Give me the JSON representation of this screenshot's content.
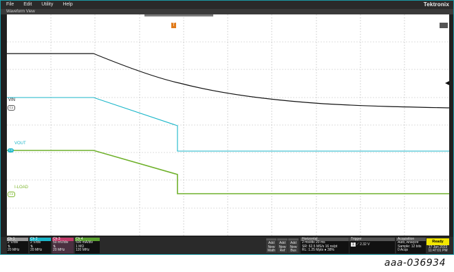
{
  "menu": {
    "items": [
      "File",
      "Edit",
      "Utility",
      "Help"
    ],
    "brand": "Tektronix"
  },
  "waveform_view": {
    "title": "Waveform View"
  },
  "trigger_marker": "T",
  "traces": {
    "c1": {
      "label": "VIN",
      "tag": "C1",
      "color": "#19b6c9"
    },
    "c3": {
      "label": "VOUT",
      "tag": "C3",
      "color": "#19b6c9"
    },
    "c4": {
      "label": "I-LOAD",
      "tag": "C4",
      "color": "#7bb52a"
    }
  },
  "channels": [
    {
      "name": "Ch 1",
      "scale": "2 V/div",
      "imp": "",
      "bw": "20 MHz",
      "color": "#c9c9c9"
    },
    {
      "name": "Ch 2",
      "scale": "2 V/div",
      "imp": "",
      "bw": "20 MHz",
      "color": "#19b6c9"
    },
    {
      "name": "Ch 3",
      "scale": "50 mV/div",
      "imp": "",
      "bw": "20 MHz",
      "color": "#c23a6a"
    },
    {
      "name": "Ch 4",
      "scale": "500 mA/div",
      "imp": "1 MΩ",
      "bw": "120 MHz",
      "color": "#5aa030"
    }
  ],
  "add_buttons": [
    {
      "line1": "Add",
      "line2": "New",
      "line3": "Math"
    },
    {
      "line1": "Add",
      "line2": "New",
      "line3": "Ref"
    },
    {
      "line1": "Add",
      "line2": "New",
      "line3": "Bus"
    }
  ],
  "horizontal": {
    "title": "Horizontal",
    "line1": "2 ms/div    20 ms",
    "line2": "SR: 62.5 MS/s  16 ns/pt",
    "line3": "RL: 1.25 Mpts  ● 38%"
  },
  "trigger": {
    "title": "Trigger",
    "source": "1",
    "level": "2.32 V"
  },
  "acquisition": {
    "title": "Acquisition",
    "line1": "Auto,        Analyze",
    "line2": "Sample: 12 bits",
    "line3": "0 Acqs"
  },
  "status": {
    "ready": "Ready",
    "date": "17 Jan 2023",
    "time": "11:47:01 PM"
  },
  "caption": "aaa-036934"
}
